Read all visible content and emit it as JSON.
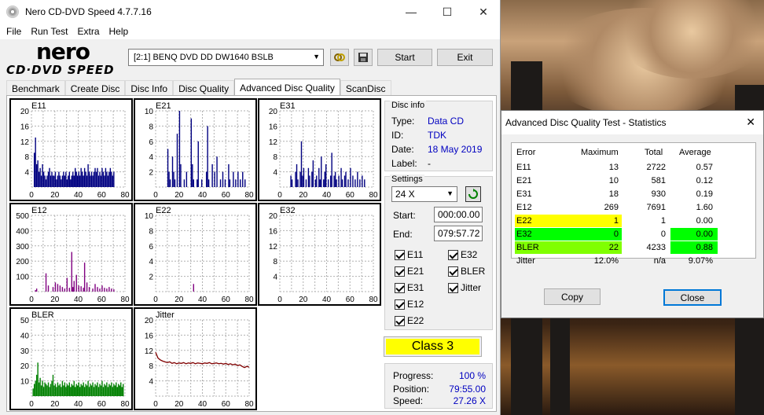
{
  "app": {
    "title": "Nero CD-DVD Speed 4.7.7.16",
    "minimize": "—",
    "maximize": "☐",
    "close": "✕"
  },
  "menu": [
    "File",
    "Run Test",
    "Extra",
    "Help"
  ],
  "logo": {
    "top": "nero",
    "bottom": "CD·DVD SPEED"
  },
  "toolbar": {
    "drive": "[2:1]   BENQ DVD DD DW1640 BSLB",
    "start_label": "Start",
    "exit_label": "Exit",
    "icons": [
      "chain-icon",
      "save-icon"
    ]
  },
  "tabs": [
    "Benchmark",
    "Create Disc",
    "Disc Info",
    "Disc Quality",
    "Advanced Disc Quality",
    "ScanDisc"
  ],
  "active_tab": "Advanced Disc Quality",
  "graphs": [
    {
      "name": "E11",
      "yticks": [
        "20",
        "16",
        "12",
        "8",
        "4"
      ],
      "xticks": [
        "0",
        "20",
        "40",
        "60",
        "80"
      ],
      "color": "#000080",
      "max": 20,
      "kind": "bars",
      "bars": [
        [
          2,
          9
        ],
        [
          3,
          13
        ],
        [
          4,
          6
        ],
        [
          5,
          7
        ],
        [
          6,
          4
        ],
        [
          7,
          5
        ],
        [
          8,
          3
        ],
        [
          9,
          6
        ],
        [
          10,
          4
        ],
        [
          11,
          3
        ],
        [
          12,
          2
        ],
        [
          13,
          3
        ],
        [
          14,
          4
        ],
        [
          15,
          5
        ],
        [
          16,
          3
        ],
        [
          17,
          4
        ],
        [
          18,
          3
        ],
        [
          19,
          3
        ],
        [
          20,
          4
        ],
        [
          21,
          2
        ],
        [
          22,
          3
        ],
        [
          23,
          4
        ],
        [
          24,
          3
        ],
        [
          25,
          2
        ],
        [
          26,
          3
        ],
        [
          27,
          4
        ],
        [
          28,
          3
        ],
        [
          29,
          4
        ],
        [
          30,
          2
        ],
        [
          31,
          3
        ],
        [
          32,
          4
        ],
        [
          33,
          2
        ],
        [
          34,
          3
        ],
        [
          35,
          4
        ],
        [
          36,
          3
        ],
        [
          37,
          5
        ],
        [
          38,
          4
        ],
        [
          39,
          3
        ],
        [
          40,
          4
        ],
        [
          41,
          3
        ],
        [
          42,
          5
        ],
        [
          43,
          4
        ],
        [
          44,
          3
        ],
        [
          45,
          5
        ],
        [
          46,
          4
        ],
        [
          47,
          3
        ],
        [
          48,
          6
        ],
        [
          49,
          4
        ],
        [
          50,
          3
        ],
        [
          51,
          4
        ],
        [
          52,
          3
        ],
        [
          53,
          4
        ],
        [
          54,
          5
        ],
        [
          55,
          4
        ],
        [
          56,
          5
        ],
        [
          57,
          3
        ],
        [
          58,
          4
        ],
        [
          59,
          3
        ],
        [
          60,
          5
        ],
        [
          61,
          4
        ],
        [
          62,
          3
        ],
        [
          63,
          5
        ],
        [
          64,
          4
        ],
        [
          65,
          3
        ],
        [
          66,
          4
        ],
        [
          67,
          5
        ],
        [
          68,
          4
        ],
        [
          69,
          3
        ],
        [
          70,
          4
        ]
      ]
    },
    {
      "name": "E21",
      "yticks": [
        "10",
        "8",
        "6",
        "4",
        "2"
      ],
      "xticks": [
        "0",
        "20",
        "40",
        "60",
        "80"
      ],
      "color": "#000080",
      "max": 10,
      "kind": "bars",
      "bars": [
        [
          10,
          5
        ],
        [
          11,
          2
        ],
        [
          12,
          1
        ],
        [
          14,
          4
        ],
        [
          15,
          2
        ],
        [
          16,
          1
        ],
        [
          18,
          7
        ],
        [
          20,
          10
        ],
        [
          21,
          3
        ],
        [
          24,
          1
        ],
        [
          26,
          2
        ],
        [
          30,
          9
        ],
        [
          31,
          3
        ],
        [
          32,
          1
        ],
        [
          35,
          1
        ],
        [
          36,
          6
        ],
        [
          39,
          1
        ],
        [
          43,
          2
        ],
        [
          44,
          8
        ],
        [
          45,
          1
        ],
        [
          48,
          3
        ],
        [
          50,
          2
        ],
        [
          52,
          4
        ],
        [
          55,
          1
        ],
        [
          57,
          2
        ],
        [
          59,
          1
        ],
        [
          62,
          3
        ],
        [
          63,
          1
        ],
        [
          66,
          2
        ],
        [
          68,
          1
        ],
        [
          70,
          2
        ],
        [
          72,
          1
        ],
        [
          74,
          2
        ],
        [
          76,
          1
        ]
      ]
    },
    {
      "name": "E31",
      "yticks": [
        "20",
        "16",
        "12",
        "8",
        "4"
      ],
      "xticks": [
        "0",
        "20",
        "40",
        "60",
        "80"
      ],
      "color": "#000080",
      "max": 20,
      "kind": "bars",
      "bars": [
        [
          9,
          3
        ],
        [
          10,
          2
        ],
        [
          13,
          4
        ],
        [
          14,
          6
        ],
        [
          15,
          2
        ],
        [
          17,
          4
        ],
        [
          18,
          12
        ],
        [
          19,
          3
        ],
        [
          20,
          5
        ],
        [
          22,
          2
        ],
        [
          24,
          5
        ],
        [
          25,
          3
        ],
        [
          27,
          4
        ],
        [
          28,
          7
        ],
        [
          30,
          2
        ],
        [
          31,
          3
        ],
        [
          33,
          5
        ],
        [
          34,
          2
        ],
        [
          35,
          8
        ],
        [
          37,
          2
        ],
        [
          38,
          4
        ],
        [
          39,
          6
        ],
        [
          41,
          2
        ],
        [
          43,
          3
        ],
        [
          44,
          9
        ],
        [
          46,
          3
        ],
        [
          47,
          4
        ],
        [
          48,
          2
        ],
        [
          50,
          3
        ],
        [
          52,
          5
        ],
        [
          53,
          2
        ],
        [
          55,
          3
        ],
        [
          56,
          4
        ],
        [
          58,
          2
        ],
        [
          60,
          5
        ],
        [
          62,
          3
        ],
        [
          64,
          2
        ],
        [
          66,
          4
        ],
        [
          68,
          2
        ],
        [
          70,
          3
        ],
        [
          72,
          2
        ]
      ]
    },
    {
      "name": "E12",
      "yticks": [
        "500",
        "400",
        "300",
        "200",
        "100"
      ],
      "xticks": [
        "0",
        "20",
        "40",
        "60",
        "80"
      ],
      "color": "#800080",
      "max": 500,
      "kind": "bars",
      "bars": [
        [
          3,
          10
        ],
        [
          4,
          20
        ],
        [
          12,
          120
        ],
        [
          14,
          40
        ],
        [
          18,
          30
        ],
        [
          20,
          60
        ],
        [
          22,
          50
        ],
        [
          24,
          40
        ],
        [
          26,
          30
        ],
        [
          28,
          20
        ],
        [
          30,
          90
        ],
        [
          32,
          25
        ],
        [
          34,
          260
        ],
        [
          35,
          30
        ],
        [
          36,
          70
        ],
        [
          38,
          110
        ],
        [
          40,
          40
        ],
        [
          42,
          35
        ],
        [
          44,
          25
        ],
        [
          45,
          190
        ],
        [
          47,
          60
        ],
        [
          49,
          30
        ],
        [
          52,
          20
        ],
        [
          54,
          50
        ],
        [
          56,
          30
        ],
        [
          58,
          20
        ],
        [
          60,
          40
        ],
        [
          62,
          25
        ],
        [
          64,
          20
        ],
        [
          66,
          30
        ],
        [
          68,
          20
        ],
        [
          70,
          15
        ]
      ]
    },
    {
      "name": "E22",
      "yticks": [
        "10",
        "8",
        "6",
        "4",
        "2"
      ],
      "xticks": [
        "0",
        "20",
        "40",
        "60",
        "80"
      ],
      "color": "#800080",
      "max": 10,
      "kind": "bars",
      "bars": [
        [
          32,
          1
        ]
      ]
    },
    {
      "name": "E32",
      "yticks": [
        "20",
        "16",
        "12",
        "8",
        "4"
      ],
      "xticks": [
        "0",
        "20",
        "40",
        "60",
        "80"
      ],
      "color": "#800080",
      "max": 20,
      "kind": "bars",
      "bars": []
    },
    {
      "name": "BLER",
      "yticks": [
        "50",
        "40",
        "30",
        "20",
        "10"
      ],
      "xticks": [
        "0",
        "20",
        "40",
        "60",
        "80"
      ],
      "color": "#008000",
      "max": 50,
      "kind": "bars",
      "bars": [
        [
          1,
          5
        ],
        [
          2,
          8
        ],
        [
          3,
          10
        ],
        [
          4,
          14
        ],
        [
          5,
          22
        ],
        [
          6,
          9
        ],
        [
          7,
          12
        ],
        [
          8,
          7
        ],
        [
          9,
          10
        ],
        [
          10,
          6
        ],
        [
          11,
          9
        ],
        [
          12,
          8
        ],
        [
          13,
          7
        ],
        [
          14,
          9
        ],
        [
          15,
          6
        ],
        [
          16,
          8
        ],
        [
          17,
          10
        ],
        [
          18,
          14
        ],
        [
          19,
          7
        ],
        [
          20,
          8
        ],
        [
          21,
          6
        ],
        [
          22,
          9
        ],
        [
          23,
          7
        ],
        [
          24,
          8
        ],
        [
          25,
          6
        ],
        [
          26,
          10
        ],
        [
          27,
          7
        ],
        [
          28,
          9
        ],
        [
          29,
          6
        ],
        [
          30,
          8
        ],
        [
          31,
          7
        ],
        [
          32,
          9
        ],
        [
          33,
          6
        ],
        [
          34,
          8
        ],
        [
          35,
          7
        ],
        [
          36,
          10
        ],
        [
          37,
          6
        ],
        [
          38,
          8
        ],
        [
          39,
          7
        ],
        [
          40,
          9
        ],
        [
          41,
          6
        ],
        [
          42,
          8
        ],
        [
          43,
          7
        ],
        [
          44,
          9
        ],
        [
          45,
          6
        ],
        [
          46,
          8
        ],
        [
          47,
          7
        ],
        [
          48,
          10
        ],
        [
          49,
          6
        ],
        [
          50,
          8
        ],
        [
          51,
          7
        ],
        [
          52,
          9
        ],
        [
          53,
          6
        ],
        [
          54,
          8
        ],
        [
          55,
          7
        ],
        [
          56,
          9
        ],
        [
          57,
          6
        ],
        [
          58,
          8
        ],
        [
          59,
          7
        ],
        [
          60,
          10
        ],
        [
          61,
          6
        ],
        [
          62,
          8
        ],
        [
          63,
          7
        ],
        [
          64,
          9
        ],
        [
          65,
          6
        ],
        [
          66,
          8
        ],
        [
          67,
          7
        ],
        [
          68,
          9
        ],
        [
          69,
          6
        ],
        [
          70,
          8
        ],
        [
          71,
          7
        ],
        [
          72,
          9
        ],
        [
          73,
          6
        ],
        [
          74,
          8
        ],
        [
          75,
          7
        ],
        [
          76,
          9
        ],
        [
          77,
          6
        ],
        [
          78,
          8
        ]
      ]
    },
    {
      "name": "Jitter",
      "yticks": [
        "20",
        "16",
        "12",
        "8",
        "4"
      ],
      "xticks": [
        "0",
        "20",
        "40",
        "60",
        "80"
      ],
      "color": "#800000",
      "max": 20,
      "kind": "line",
      "points": [
        [
          0,
          11.5
        ],
        [
          2,
          10
        ],
        [
          4,
          9.5
        ],
        [
          6,
          9.2
        ],
        [
          8,
          9
        ],
        [
          10,
          8.8
        ],
        [
          12,
          9
        ],
        [
          14,
          8.6
        ],
        [
          16,
          8.8
        ],
        [
          18,
          8.5
        ],
        [
          20,
          8.7
        ],
        [
          22,
          8.6
        ],
        [
          24,
          8.8
        ],
        [
          26,
          8.5
        ],
        [
          28,
          8.7
        ],
        [
          30,
          8.6
        ],
        [
          32,
          8.8
        ],
        [
          34,
          8.5
        ],
        [
          36,
          8.7
        ],
        [
          38,
          8.6
        ],
        [
          40,
          8.5
        ],
        [
          42,
          8.7
        ],
        [
          44,
          8.6
        ],
        [
          46,
          8.8
        ],
        [
          48,
          8.5
        ],
        [
          50,
          8.6
        ],
        [
          52,
          8.7
        ],
        [
          54,
          8.5
        ],
        [
          56,
          8.6
        ],
        [
          58,
          8.4
        ],
        [
          60,
          8.6
        ],
        [
          62,
          8.3
        ],
        [
          64,
          8.5
        ],
        [
          66,
          8.2
        ],
        [
          68,
          8.4
        ],
        [
          70,
          8
        ],
        [
          72,
          8.2
        ],
        [
          74,
          7.8
        ],
        [
          76,
          7.5
        ],
        [
          78,
          7.8
        ],
        [
          80,
          7.6
        ]
      ]
    }
  ],
  "disc_info": {
    "title": "Disc info",
    "type_label": "Type:",
    "type": "Data CD",
    "id_label": "ID:",
    "id": "TDK",
    "date_label": "Date:",
    "date": "18 May 2019",
    "label_label": "Label:",
    "label": "-"
  },
  "settings": {
    "title": "Settings",
    "speed": "24 X",
    "start_label": "Start:",
    "start": "000:00.00",
    "end_label": "End:",
    "end": "079:57.72",
    "checks": [
      "E11",
      "E21",
      "E31",
      "E12",
      "E22",
      "E32",
      "BLER",
      "Jitter"
    ]
  },
  "class_label": "Class 3",
  "progress": {
    "progress_label": "Progress:",
    "progress": "100 %",
    "position_label": "Position:",
    "position": "79:55.00",
    "speed_label": "Speed:",
    "speed": "27.26 X"
  },
  "stats": {
    "title": "Advanced Disc Quality Test - Statistics",
    "headers": [
      "Error",
      "Maximum",
      "Total",
      "Average"
    ],
    "rows": [
      {
        "error": "E11",
        "maximum": "13",
        "total": "2722",
        "average": "0.57"
      },
      {
        "error": "E21",
        "maximum": "10",
        "total": "581",
        "average": "0.12"
      },
      {
        "error": "E31",
        "maximum": "18",
        "total": "930",
        "average": "0.19"
      },
      {
        "error": "E12",
        "maximum": "269",
        "total": "7691",
        "average": "1.60"
      },
      {
        "error": "E22",
        "maximum": "1",
        "total": "1",
        "average": "0.00"
      },
      {
        "error": "E32",
        "maximum": "0",
        "total": "0",
        "average": "0.00"
      },
      {
        "error": "BLER",
        "maximum": "22",
        "total": "4233",
        "average": "0.88"
      },
      {
        "error": "Jitter",
        "maximum": "12.0%",
        "total": "n/a",
        "average": "9.07%"
      }
    ],
    "copy_label": "Copy",
    "close_label": "Close",
    "highlight_colors": {
      "yellow": "#ffff00",
      "green": "#00ff00",
      "lime": "#80ff00"
    }
  }
}
